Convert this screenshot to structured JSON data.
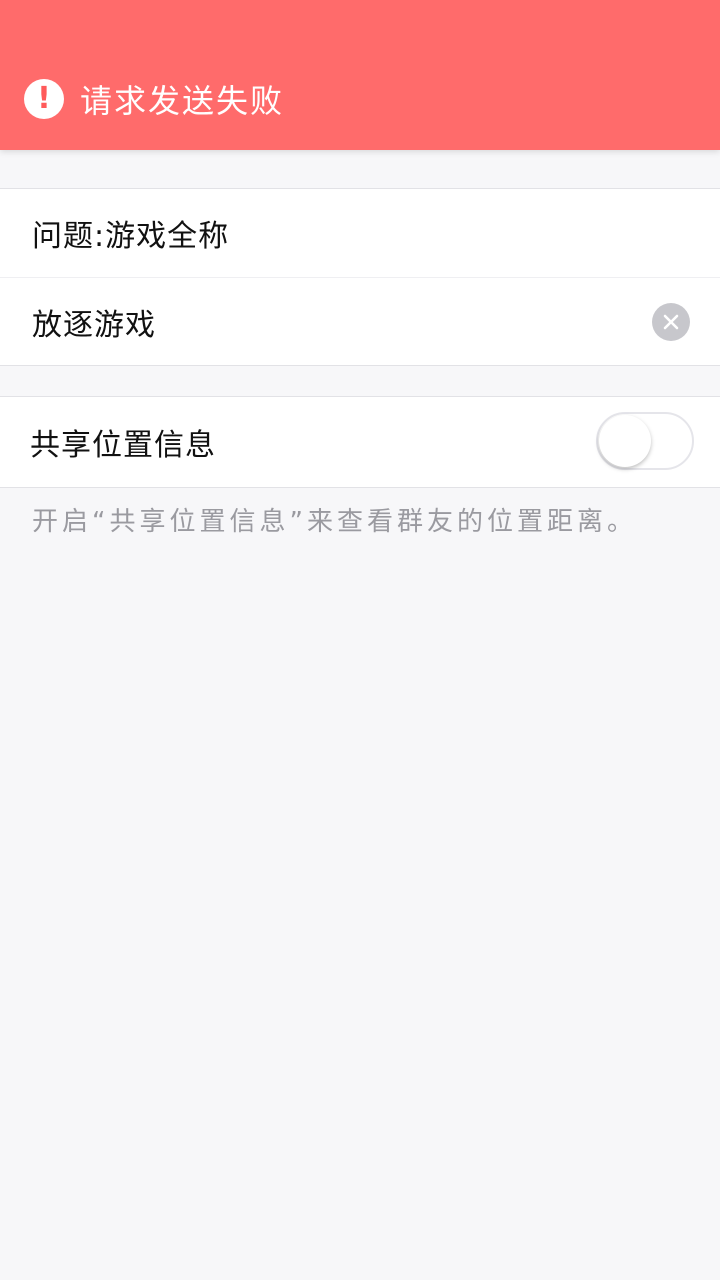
{
  "error_banner": {
    "icon": "exclamation-icon",
    "message": "请求发送失败"
  },
  "question_group": {
    "question_label": "问题:游戏全称",
    "answer_value": "放逐游戏",
    "clear_icon": "clear-circle-icon"
  },
  "location_group": {
    "label": "共享位置信息",
    "toggle_on": false
  },
  "hint": "开启“共享位置信息”来查看群友的位置距离。",
  "colors": {
    "banner": "#ff6b6b",
    "background": "#f7f7f9",
    "hint_text": "#9a9aa0"
  }
}
